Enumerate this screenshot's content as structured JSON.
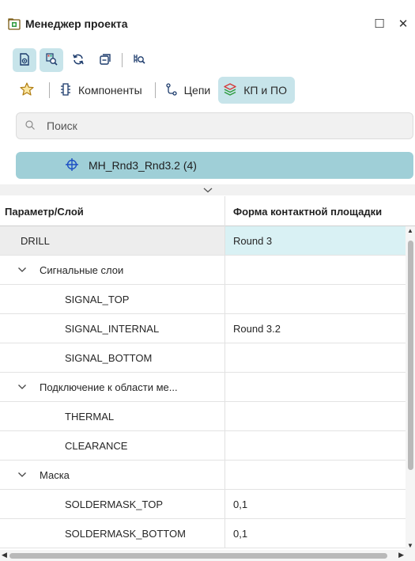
{
  "window": {
    "title": "Менеджер проекта",
    "maximize_glyph": "☐",
    "close_glyph": "✕"
  },
  "toolbar": {
    "buttons": [
      {
        "icon": "view-mode-icon",
        "active": true
      },
      {
        "icon": "find-icon",
        "active": true
      },
      {
        "icon": "refresh-icon",
        "active": false
      },
      {
        "icon": "collapse-icon",
        "active": false
      },
      {
        "icon": "search-component-icon",
        "active": false
      }
    ]
  },
  "tabs": {
    "favorites_icon": "star-icon",
    "items": [
      {
        "label": "Компоненты",
        "icon": "component-icon",
        "active": false
      },
      {
        "label": "Цепи",
        "icon": "net-icon",
        "active": false
      },
      {
        "label": "КП и ПО",
        "icon": "layers-icon",
        "active": true
      }
    ]
  },
  "search": {
    "placeholder": "Поиск",
    "value": ""
  },
  "pad_stack": {
    "name": "MH_Rnd3_Rnd3.2 (4)"
  },
  "table": {
    "headers": [
      "Параметр/Слой",
      "Форма контактной площадки"
    ],
    "rows": [
      {
        "name": "DRILL",
        "value": "Round 3",
        "type": "item0",
        "selected": true
      },
      {
        "name": "Сигнальные слои",
        "value": "",
        "type": "group"
      },
      {
        "name": "SIGNAL_TOP",
        "value": "",
        "type": "item1"
      },
      {
        "name": "SIGNAL_INTERNAL",
        "value": "Round 3.2",
        "type": "item1"
      },
      {
        "name": "SIGNAL_BOTTOM",
        "value": "",
        "type": "item1"
      },
      {
        "name": "Подключение к области ме...",
        "value": "",
        "type": "group"
      },
      {
        "name": "THERMAL",
        "value": "",
        "type": "item1"
      },
      {
        "name": "CLEARANCE",
        "value": "",
        "type": "item1"
      },
      {
        "name": "Маска",
        "value": "",
        "type": "group"
      },
      {
        "name": "SOLDERMASK_TOP",
        "value": "0,1",
        "type": "item1"
      },
      {
        "name": "SOLDERMASK_BOTTOM",
        "value": "0,1",
        "type": "item1"
      }
    ]
  },
  "colors": {
    "accent": "#9fcfd7",
    "active_button": "#c7e4ea",
    "selected_cell": "#d9f1f4"
  }
}
